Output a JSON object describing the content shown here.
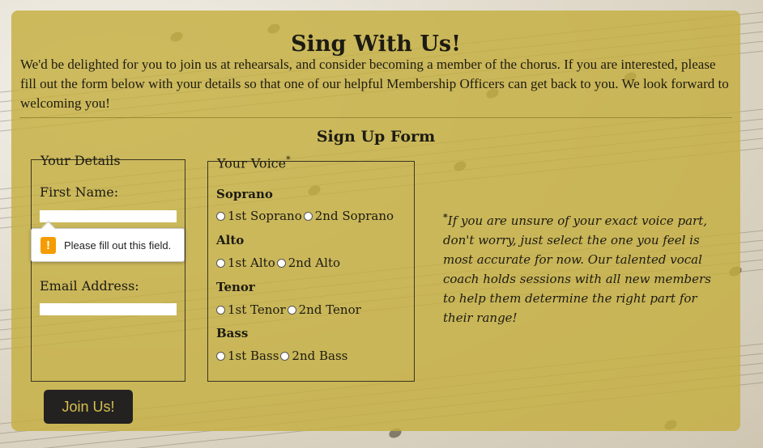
{
  "page": {
    "title": "Sing With Us!",
    "intro": "We'd be delighted for you to join us at rehearsals, and consider becoming a member of the chorus. If you are interested, please fill out the form below with your details so that one of our helpful Membership Officers can get back to you. We look forward to welcoming you!",
    "form_title": "Sign Up Form"
  },
  "details": {
    "legend": "Your Details",
    "first_name_label": "First Name:",
    "email_label": "Email Address:",
    "first_name_value": "",
    "email_value": ""
  },
  "validation": {
    "icon": "warning-icon",
    "message": "Please fill out this field."
  },
  "voice": {
    "legend": "Your Voice",
    "asterisk": "*",
    "groups": [
      {
        "label": "Soprano",
        "options": [
          "1st Soprano",
          "2nd Soprano"
        ]
      },
      {
        "label": "Alto",
        "options": [
          "1st Alto",
          "2nd Alto"
        ]
      },
      {
        "label": "Tenor",
        "options": [
          "1st Tenor",
          "2nd Tenor"
        ]
      },
      {
        "label": "Bass",
        "options": [
          "1st Bass",
          "2nd Bass"
        ]
      }
    ]
  },
  "note": {
    "asterisk": "*",
    "text": "If you are unsure of your exact voice part, don't worry, just select the one you feel is most accurate for now. Our talented vocal coach holds sessions with all new members to help them determine the right part for their range!"
  },
  "submit": {
    "label": "Join Us!"
  },
  "colors": {
    "panel": "#c4ae40",
    "button_bg": "#232221",
    "button_text": "#d8bf4f",
    "warning": "#f59c00"
  }
}
